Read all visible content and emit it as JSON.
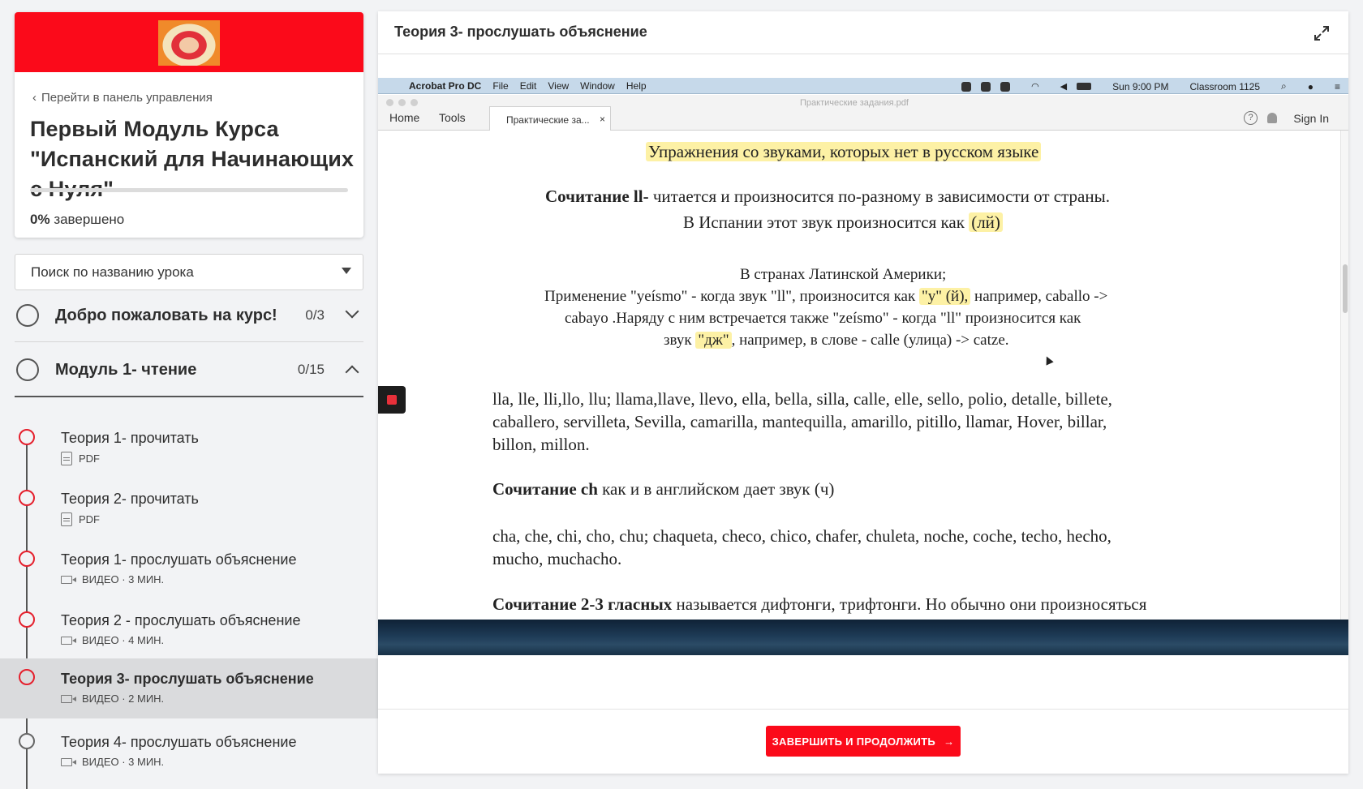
{
  "sidebar": {
    "back_label": "Перейти в панель управления",
    "course_title": "Первый Модуль Курса \"Испанский для Начинающих с Нуля\"",
    "progress_percent": "0%",
    "progress_suffix": "завершено",
    "progress_value": 0,
    "search_placeholder": "Поиск по названию урока",
    "sections": [
      {
        "title": "Добро пожаловать на курс!",
        "count": "0/3",
        "expanded": false
      },
      {
        "title": "Модуль 1- чтение",
        "count": "0/15",
        "expanded": true
      }
    ],
    "lessons": [
      {
        "title": "Теория 1- прочитать",
        "meta": "PDF",
        "type": "pdf-icon"
      },
      {
        "title": "Теория 2- прочитать",
        "meta": "PDF",
        "type": "pdf-icon"
      },
      {
        "title": "Теория 1- прослушать объяснение",
        "meta": "ВИДЕО · 3 МИН.",
        "type": "video-icon"
      },
      {
        "title": "Теория 2 - прослушать объяснение",
        "meta": "ВИДЕО · 4 МИН.",
        "type": "video-icon"
      },
      {
        "title": "Теория 3- прослушать объяснение",
        "meta": "ВИДЕО · 2 МИН.",
        "type": "video-icon",
        "active": true
      },
      {
        "title": "Теория 4- прослушать объяснение",
        "meta": "ВИДЕО · 3 МИН.",
        "type": "video-icon"
      }
    ]
  },
  "main": {
    "title": "Теория 3- прослушать объяснение",
    "complete_button": "ЗАВЕРШИТЬ И ПРОДОЛЖИТЬ",
    "complete_arrow": "→"
  },
  "video": {
    "mac_menu": {
      "app": "Acrobat Pro DC",
      "items": [
        "File",
        "Edit",
        "View",
        "Window",
        "Help"
      ],
      "time": "Sun 9:00 PM",
      "user": "Classroom 1125"
    },
    "acrobat": {
      "doc_name": "Практические задания.pdf",
      "tab_home": "Home",
      "tab_tools": "Tools",
      "tab_doc": "Практические за...",
      "tab_close": "×",
      "help": "?",
      "sign_in": "Sign In"
    },
    "pdf": {
      "heading": "Упражнения со звуками, которых нет в русском языке",
      "ll_bold": "Сочитание ll-",
      "ll_rest": "читается и произносится по-разному в зависимости от страны.",
      "spain_text": "В Испании этот звук произносится как",
      "spain_hl": "(лй)",
      "latam_line": "В странах Латинской Америки;",
      "yeismo_pre": "Применение \"yeísmo\" - когда звук \"ll\", произносится как",
      "yeismo_hl": "\"y\" (й),",
      "yeismo_post": "например, caballo ->",
      "zeismo_line": "cabayo  .Наряду с ним встречается также \"zeísmo\" - когда \"ll\" произносится как",
      "dzh_pre": "звук",
      "dzh_hl": "\"дж\"",
      "dzh_post": ", например, в слове - calle (улица) -> catze.",
      "words_1": "lla, lle, lli,llo, llu; llama,llave, llevo, ella, bella, silla, calle, elle, sello, polio,  detalle, billete,",
      "words_2": "caballero, servilleta, Sevilla, camarilla, mantequilla, amarillo, pitillo,  llamar, Hover, billar,",
      "words_3": "billon, millon.",
      "ch_bold": "Сочитание ch",
      "ch_rest": "как и в английском дает звук (ч)",
      "ch_words_1": "cha, che, chi, cho, chu; chaqueta, checo, chico, chafer, chuleta, noche, coche,  techo, hecho,",
      "ch_words_2": "mucho, muchacho.",
      "vowels_bold": "Сочитание 2-3 гласных",
      "vowels_rest": "называется дифтонги, трифтонги. Но обычно они произносяться"
    }
  },
  "colors": {
    "accent": "#fb0a1a",
    "highlight": "#fdf1a5",
    "active_row": "#dadbdd"
  }
}
